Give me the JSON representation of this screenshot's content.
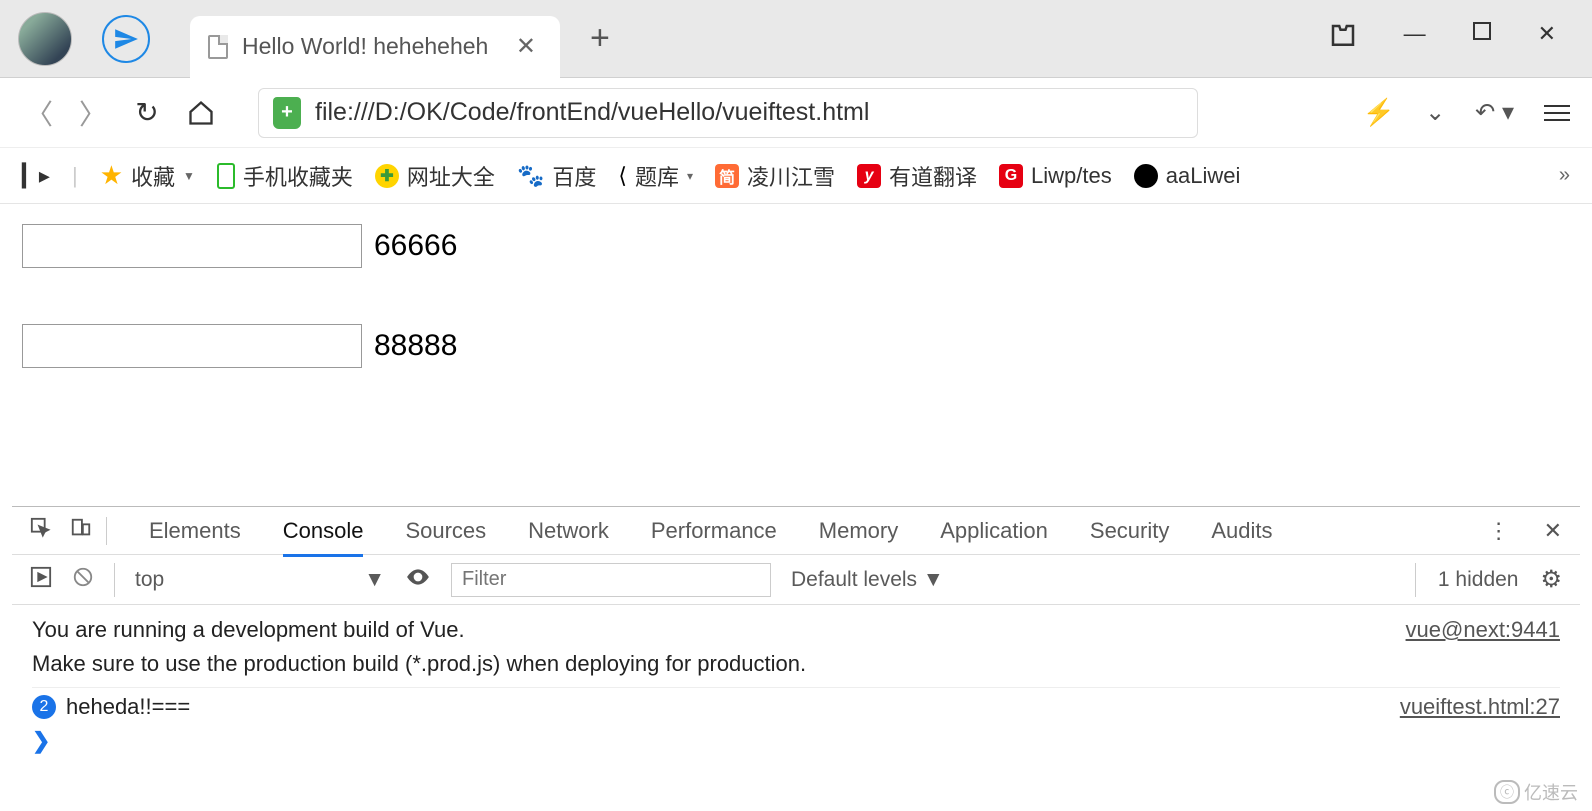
{
  "titlebar": {
    "tab_title": "Hello World! heheheheh",
    "win": {
      "shirt": "👕",
      "min": "—",
      "max": "□",
      "close": "✕"
    }
  },
  "addr": {
    "url": "file:///D:/OK/Code/frontEnd/vueHello/vueiftest.html"
  },
  "bookmarks": {
    "fav": "收藏",
    "phone": "手机收藏夹",
    "w360": "网址大全",
    "baidu": "百度",
    "tiku": "题库",
    "jian": "凌川江雪",
    "youdao": "有道翻译",
    "liwp": "Liwp/tes",
    "gh": "aaLiwei",
    "more": "»"
  },
  "page": {
    "val1": "66666",
    "val2": "88888"
  },
  "devtools": {
    "tabs": {
      "elements": "Elements",
      "console": "Console",
      "sources": "Sources",
      "network": "Network",
      "performance": "Performance",
      "memory": "Memory",
      "application": "Application",
      "security": "Security",
      "audits": "Audits"
    },
    "filter": {
      "context": "top",
      "placeholder": "Filter",
      "levels": "Default levels ▼",
      "hidden": "1 hidden"
    },
    "logs": {
      "warn1": "You are running a development build of Vue.",
      "warn2": "Make sure to use the production build (*.prod.js) when deploying for production.",
      "warn_src": "vue@next:9441",
      "count": "2",
      "msg": "heheda!!===",
      "msg_src": "vueiftest.html:27"
    }
  },
  "watermark": "亿速云"
}
